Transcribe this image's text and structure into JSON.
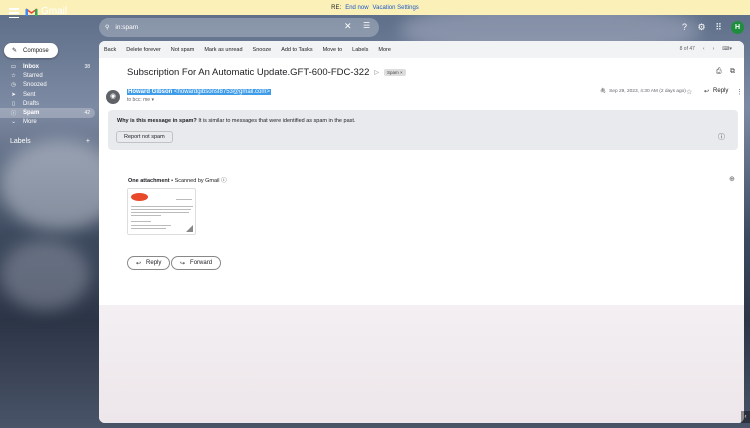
{
  "banner": {
    "prefix": "RE:",
    "end_now": "End now",
    "vacation_settings": "Vacation Settings"
  },
  "app": {
    "name": "Gmail"
  },
  "search": {
    "value": "in:spam"
  },
  "compose": {
    "label": "Compose"
  },
  "nav": [
    {
      "label": "Inbox",
      "count": "38",
      "icon": "inbox-icon",
      "glyph": "▭"
    },
    {
      "label": "Starred",
      "count": "",
      "icon": "star-icon",
      "glyph": "☆"
    },
    {
      "label": "Snoozed",
      "count": "",
      "icon": "clock-icon",
      "glyph": "◷"
    },
    {
      "label": "Sent",
      "count": "",
      "icon": "send-icon",
      "glyph": "➤"
    },
    {
      "label": "Drafts",
      "count": "",
      "icon": "draft-icon",
      "glyph": "▯"
    },
    {
      "label": "Spam",
      "count": "42",
      "icon": "spam-icon",
      "glyph": "ⓘ"
    },
    {
      "label": "More",
      "count": "",
      "icon": "chevron-down-icon",
      "glyph": "⌄"
    }
  ],
  "labels": {
    "title": "Labels",
    "add": "+"
  },
  "toolbar": {
    "back": "Back",
    "delete": "Delete forever",
    "not_spam": "Not spam",
    "mark_unread": "Mark as unread",
    "snooze": "Snooze",
    "add_tasks": "Add to Tasks",
    "move_to": "Move to",
    "labels": "Labels",
    "more": "More",
    "pager": "8 of 47"
  },
  "message": {
    "subject": "Subscription For An Automatic Update.GFT-600-FDC-322",
    "tag": "Spam",
    "sender_name": "Howard Gibson",
    "sender_email": "<howardgibsonsf8753@gmail.com>",
    "to": "to bcc: me",
    "date": "Sep 29, 2023, 4:30 AM (2 days ago)",
    "reply": "Reply"
  },
  "spam_notice": {
    "question": "Why is this message in spam?",
    "reason": "It is similar to messages that were identified as spam in the past.",
    "report_button": "Report not spam"
  },
  "attachment": {
    "title": "One attachment",
    "separator": "•",
    "scanned": "Scanned by Gmail"
  },
  "actions": {
    "reply": "Reply",
    "forward": "Forward"
  },
  "colors": {
    "banner": "#fbf1b8",
    "avatar": "#1e8e3e",
    "highlight": "#3f9ce8"
  }
}
